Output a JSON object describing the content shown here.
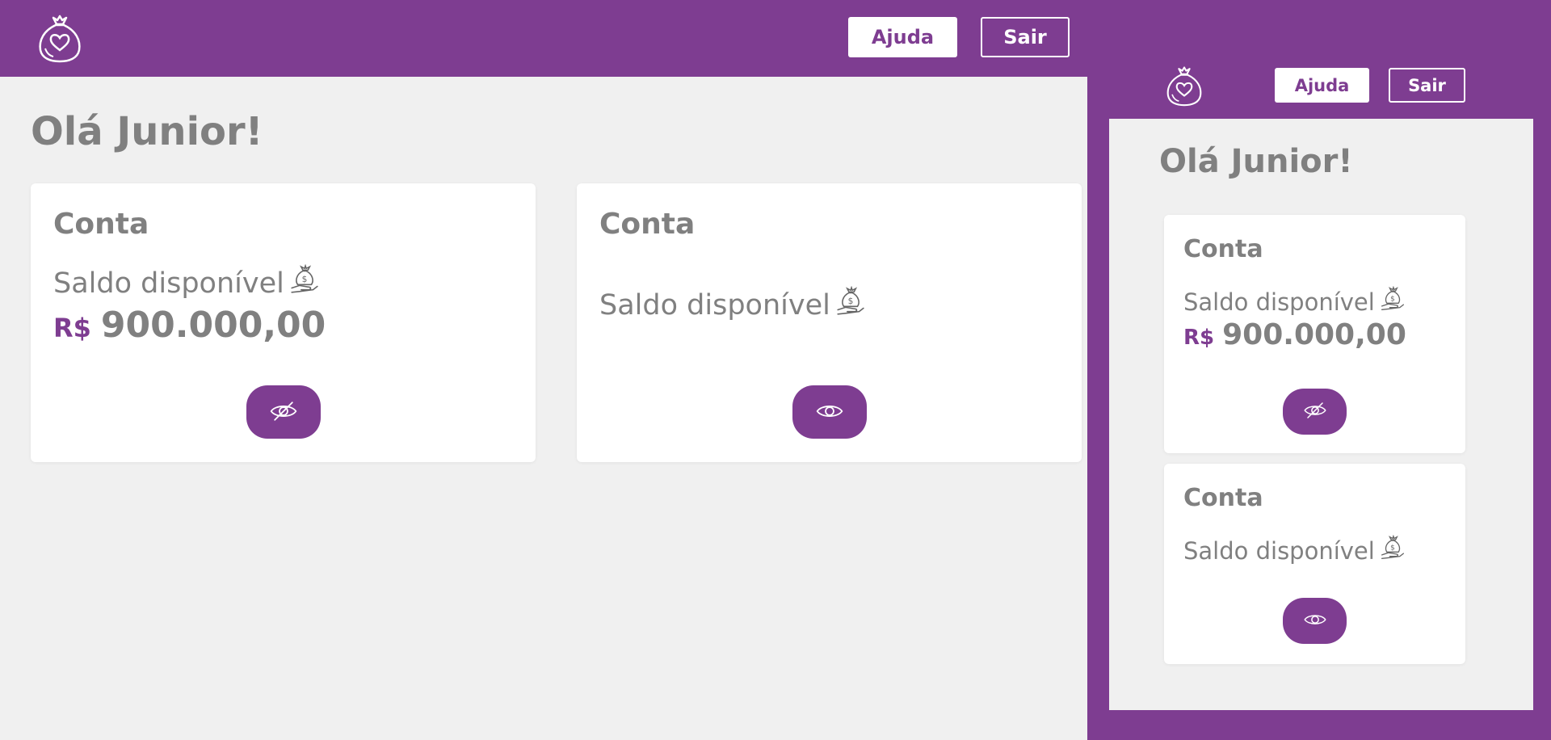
{
  "desktop": {
    "logo_icon": "money-bag-heart-logo",
    "help_label": "Ajuda",
    "exit_label": "Sair",
    "greeting": "Olá Junior!",
    "cards": [
      {
        "title": "Conta",
        "balance_label": "Saldo disponível",
        "currency": "R$",
        "amount": "900.000,00",
        "toggle_icon": "eye-slash-icon"
      },
      {
        "title": "Conta",
        "balance_label": "Saldo disponível",
        "toggle_icon": "eye-icon"
      }
    ]
  },
  "mobile": {
    "logo_icon": "money-bag-heart-logo",
    "help_label": "Ajuda",
    "exit_label": "Sair",
    "greeting": "Olá Junior!",
    "cards": [
      {
        "title": "Conta",
        "balance_label": "Saldo disponível",
        "currency": "R$",
        "amount": "900.000,00",
        "toggle_icon": "eye-slash-icon"
      },
      {
        "title": "Conta",
        "balance_label": "Saldo disponível",
        "toggle_icon": "eye-icon"
      }
    ]
  },
  "colors": {
    "brand": "#7e3d91",
    "background": "#f0f0f0",
    "card": "#ffffff",
    "text_gray": "#808080"
  }
}
